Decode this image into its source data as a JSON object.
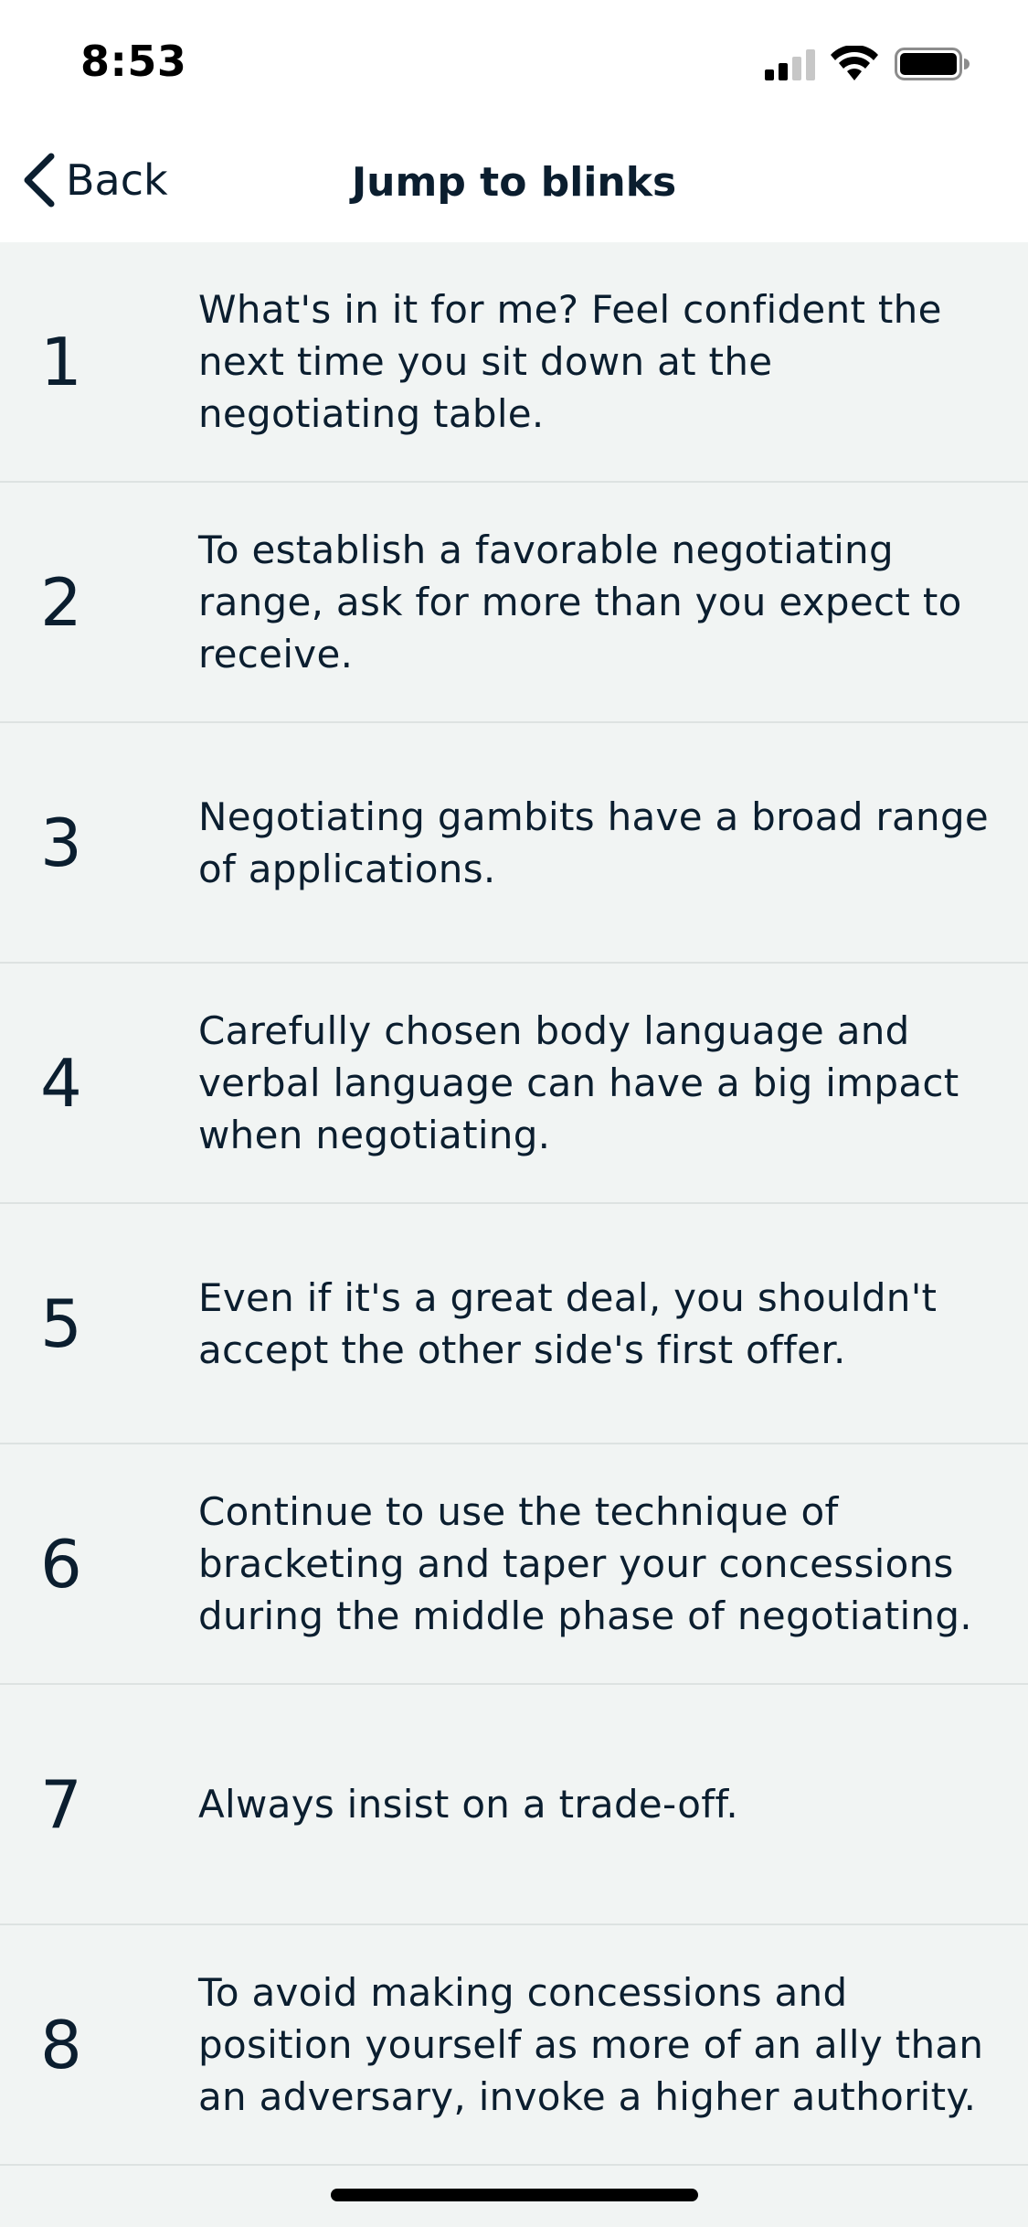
{
  "status_bar": {
    "time": "8:53"
  },
  "nav": {
    "back_label": "Back",
    "title": "Jump to blinks"
  },
  "blinks": [
    {
      "number": "1",
      "text": "What's in it for me? Feel confident the next time you sit down at the negotiating table."
    },
    {
      "number": "2",
      "text": "To establish a favorable negotiating range, ask for more than you expect to receive."
    },
    {
      "number": "3",
      "text": "Negotiating gambits have a broad range of applications."
    },
    {
      "number": "4",
      "text": "Carefully chosen body language and verbal language can have a big impact when negotiating."
    },
    {
      "number": "5",
      "text": "Even if it's a great deal, you shouldn't accept the other side's first offer."
    },
    {
      "number": "6",
      "text": "Continue to use the technique of bracketing and taper your concessions during the middle phase of negotiating."
    },
    {
      "number": "7",
      "text": "Always insist on a trade-off."
    },
    {
      "number": "8",
      "text": "To avoid making concessions and position yourself as more of an ally than an adversary, invoke a higher authority."
    }
  ],
  "icons": [
    "signal-icon",
    "wifi-icon",
    "battery-icon",
    "chevron-left-icon"
  ],
  "colors": {
    "text": "#0b1e2f",
    "list_bg": "#f1f4f3",
    "header_bg": "#ffffff",
    "divider": "#dde2e1"
  }
}
